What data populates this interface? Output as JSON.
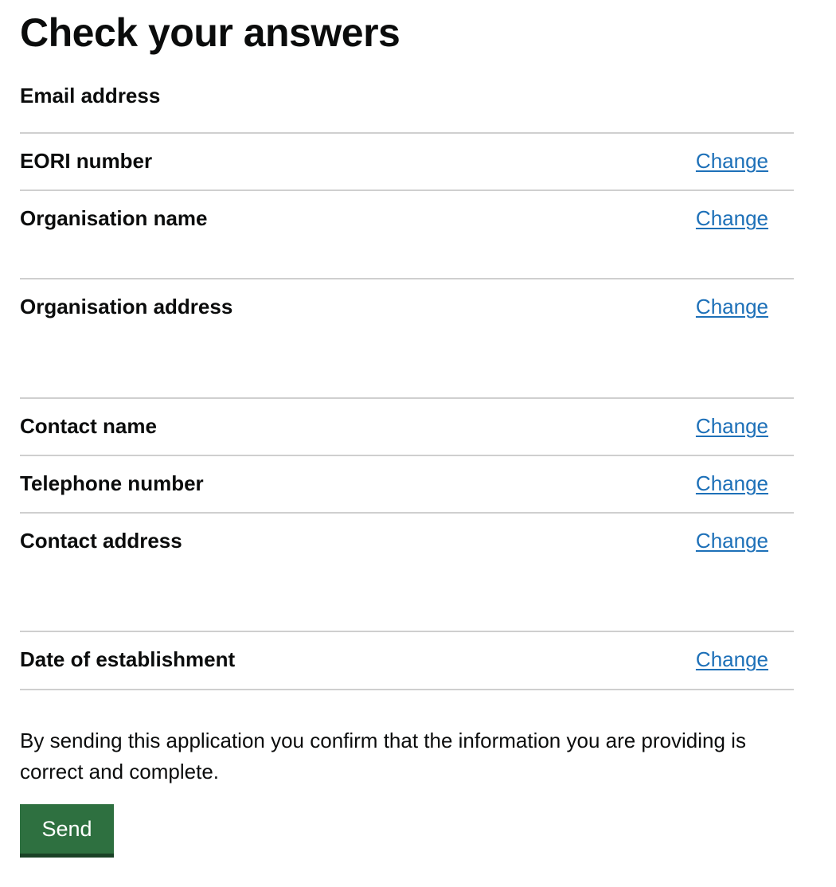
{
  "page": {
    "title": "Check your answers"
  },
  "summary": {
    "rows": [
      {
        "key": "Email address",
        "action": ""
      },
      {
        "key": "EORI number",
        "action": "Change"
      },
      {
        "key": "Organisation name",
        "action": "Change"
      },
      {
        "key": "Organisation address",
        "action": "Change"
      },
      {
        "key": "Contact name",
        "action": "Change"
      },
      {
        "key": "Telephone number",
        "action": "Change"
      },
      {
        "key": "Contact address",
        "action": "Change"
      },
      {
        "key": "Date of establishment",
        "action": "Change"
      }
    ]
  },
  "confirmation": {
    "text": "By sending this application you confirm that the information you are providing is correct and complete."
  },
  "send_button": {
    "label": "Send"
  },
  "colors": {
    "link": "#1d70b8",
    "button": "#2e7040",
    "divider": "#cfcfcf",
    "text": "#0b0c0c"
  }
}
